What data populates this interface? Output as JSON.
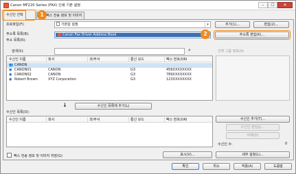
{
  "window": {
    "title": "Canon MF220 Series (FAX) 인쇄 기본 설정",
    "controls": [
      "–",
      "☐",
      "✕"
    ]
  },
  "tabs": [
    {
      "label": "수신인 선택",
      "active": true
    },
    {
      "label": "팩스 전송 정보 및 이미지",
      "active": false
    }
  ],
  "callouts": [
    "1",
    "2"
  ],
  "profile": {
    "label": "프로파일(F):",
    "value": "기본값 설정",
    "add_label": "추가(1)...",
    "edit_label": "편집(2)..."
  },
  "address_book": {
    "book_label": "주소록 목록(B):",
    "book_value": "Canon Fax Driver Address Book",
    "list_label": "주소 목록(R):",
    "edit_button": "주소록 편집(K)...",
    "search_label": "검색(S):",
    "search_value": "",
    "group_note": "선택 그룹 정보(A)"
  },
  "address_table": {
    "columns": [
      "수신인 이름",
      "회사",
      "과/부서",
      "통신 모드",
      "팩스 번호/URI"
    ],
    "rows": [
      {
        "name": "CANON",
        "company": "",
        "dept": "",
        "mode": "",
        "fax": ""
      },
      {
        "name": "CANON01",
        "company": "CANON",
        "dept": "",
        "mode": "G3",
        "fax": "456XXXXXXXX"
      },
      {
        "name": "CANON02",
        "company": "CANON",
        "dept": "",
        "mode": "G3",
        "fax": "789XXXXXXXX"
      },
      {
        "name": "Robert Brown",
        "company": "XYZ Corporation",
        "dept": "",
        "mode": "G3",
        "fax": "123XXXXXXXX"
      }
    ]
  },
  "add_to_list": {
    "arrow": "↓",
    "button": "수신인 목록에 추가(L)"
  },
  "recipients": {
    "label": "수신인 목록(O):",
    "columns": [
      "수신인 이름",
      "회사",
      "과/부서",
      "통신 모드",
      "팩스 번호/URI"
    ],
    "buttons": {
      "add": "수신인 추가(T)...",
      "edit": "수신인 편집(J)...",
      "delete": "삭제(D)"
    },
    "count_label": "수신인 수:",
    "count_value": "0"
  },
  "bottom": {
    "checkbox_label": "팩스 전송 정보 및 이미지 저장(G)",
    "display_button": "표시(V)...",
    "detail_button": "세부 설정(L)..."
  },
  "footer": {
    "ok": "확인",
    "cancel": "취소",
    "apply": "적용(A)",
    "help": "도움말"
  },
  "colors": {
    "accent": "#f08a1c",
    "close": "#c8453a",
    "selected_row": "#cfe3f7"
  }
}
